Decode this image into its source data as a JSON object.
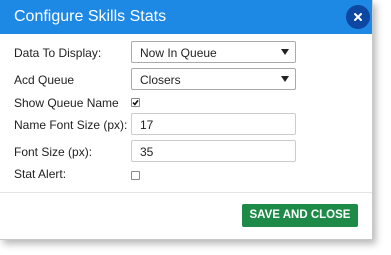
{
  "dialog": {
    "title": "Configure Skills Stats",
    "close_icon": "close-icon"
  },
  "form": {
    "data_to_display": {
      "label": "Data To Display:",
      "value": "Now In Queue"
    },
    "acd_queue": {
      "label": "Acd Queue",
      "value": "Closers"
    },
    "show_queue_name": {
      "label": "Show Queue Name",
      "checked": true
    },
    "name_font_size": {
      "label": "Name Font Size (px):",
      "value": "17"
    },
    "font_size": {
      "label": "Font Size (px):",
      "value": "35"
    },
    "stat_alert": {
      "label": "Stat Alert:",
      "checked": false
    }
  },
  "footer": {
    "save_label": "SAVE AND CLOSE"
  },
  "colors": {
    "header": "#1e88e5",
    "close_button": "#0d47a1",
    "save_button": "#1e8a48"
  }
}
